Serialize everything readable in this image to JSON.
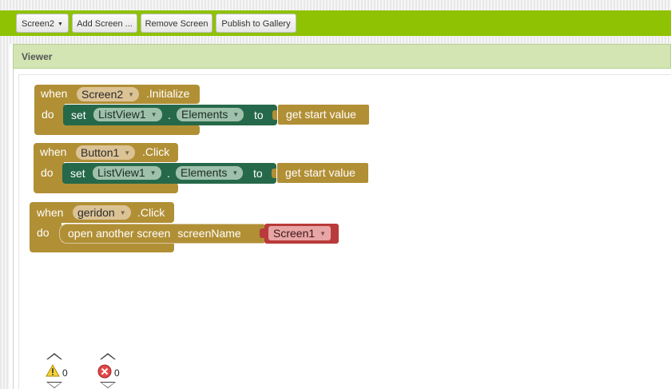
{
  "toolbar": {
    "screen_select": "Screen2",
    "add_screen": "Add Screen ...",
    "remove_screen": "Remove Screen",
    "publish": "Publish to Gallery"
  },
  "viewer": {
    "title": "Viewer"
  },
  "blocks": [
    {
      "when": "when",
      "component": "Screen2",
      "event": ".Initialize",
      "do": "do",
      "set": "set",
      "target": "ListView1",
      "dot": ".",
      "property": "Elements",
      "to": "to",
      "value": "get start value"
    },
    {
      "when": "when",
      "component": "Button1",
      "event": ".Click",
      "do": "do",
      "set": "set",
      "target": "ListView1",
      "dot": ".",
      "property": "Elements",
      "to": "to",
      "value": "get start value"
    },
    {
      "when": "when",
      "component": "geridon",
      "event": ".Click",
      "do": "do",
      "action": "open another screen",
      "param": "screenName",
      "screen": "Screen1"
    }
  ],
  "indicators": {
    "warnings": "0",
    "errors": "0"
  },
  "colors": {
    "toolbar": "#8fc202",
    "control_block": "#b18f35",
    "setter_block": "#26694a",
    "text_block": "#b93a3a"
  }
}
